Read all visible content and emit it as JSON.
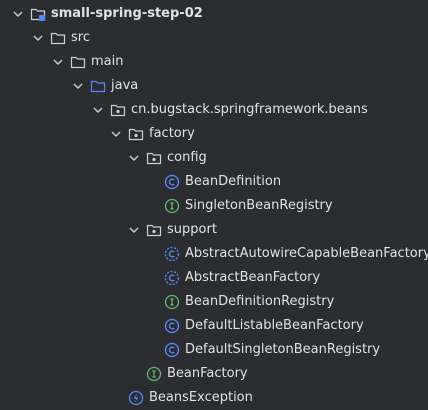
{
  "tree": {
    "root": {
      "label": "small-spring-step-02",
      "icon": "module-folder-icon"
    },
    "src": {
      "label": "src",
      "icon": "folder-icon"
    },
    "main": {
      "label": "main",
      "icon": "folder-icon"
    },
    "java": {
      "label": "java",
      "icon": "source-root-folder-icon"
    },
    "beans_pkg": {
      "label": "cn.bugstack.springframework.beans",
      "icon": "package-icon"
    },
    "factory": {
      "label": "factory",
      "icon": "package-icon"
    },
    "config": {
      "label": "config",
      "icon": "package-icon"
    },
    "bean_definition": {
      "label": "BeanDefinition",
      "icon": "class-icon"
    },
    "singleton_bean_registry": {
      "label": "SingletonBeanRegistry",
      "icon": "interface-icon"
    },
    "support": {
      "label": "support",
      "icon": "package-icon"
    },
    "abstract_autowire": {
      "label": "AbstractAutowireCapableBeanFactory",
      "icon": "abstract-class-icon"
    },
    "abstract_bean_factory": {
      "label": "AbstractBeanFactory",
      "icon": "abstract-class-icon"
    },
    "bean_definition_registry": {
      "label": "BeanDefinitionRegistry",
      "icon": "interface-icon"
    },
    "default_listable": {
      "label": "DefaultListableBeanFactory",
      "icon": "class-icon"
    },
    "default_singleton": {
      "label": "DefaultSingletonBeanRegistry",
      "icon": "class-icon"
    },
    "bean_factory": {
      "label": "BeanFactory",
      "icon": "interface-icon"
    },
    "beans_exception": {
      "label": "BeansException",
      "icon": "exception-class-icon"
    }
  },
  "colors": {
    "background": "#2b2d30",
    "text": "#dfe1e5",
    "folder": "#548af7",
    "class": "#548af7",
    "interface": "#5fb865",
    "chevron": "#ced0d6"
  }
}
